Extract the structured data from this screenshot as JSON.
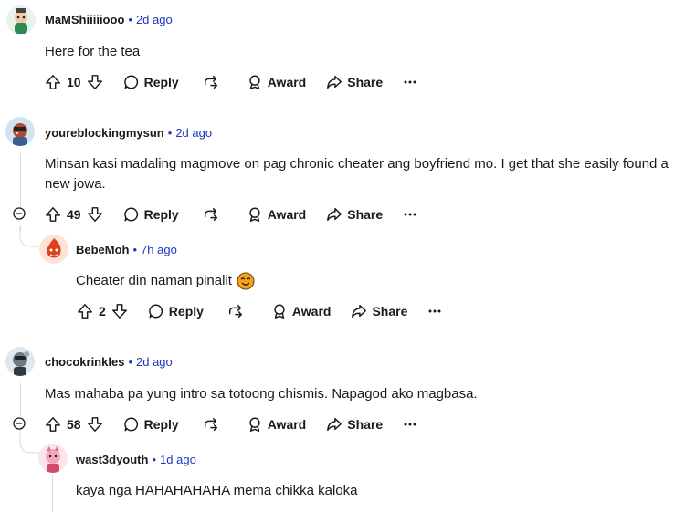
{
  "comments": [
    {
      "author": "MaMShiiiiiooo",
      "time": "2d ago",
      "body": "Here for the tea",
      "score": "10"
    },
    {
      "author": "youreblockingmysun",
      "time": "2d ago",
      "body": "Minsan kasi madaling magmove on pag chronic cheater ang boyfriend mo. I get that she easily found a new jowa.",
      "score": "49"
    },
    {
      "author": "BebeMoh",
      "time": "7h ago",
      "body": "Cheater din naman pinalit",
      "score": "2"
    },
    {
      "author": "chocokrinkles",
      "time": "2d ago",
      "body": "Mas mahaba pa yung intro sa totoong chismis. Napagod ako magbasa.",
      "score": "58"
    },
    {
      "author": "wast3dyouth",
      "time": "1d ago",
      "body": "kaya nga HAHAHAHAHA mema chikka kaloka"
    }
  ],
  "labels": {
    "separator": "•",
    "reply": "Reply",
    "award": "Award",
    "share": "Share"
  },
  "colors": {
    "link": "#1c39bb",
    "text": "#1a1a1b",
    "thread": "#d7dadc"
  },
  "icons": [
    "upvote-icon",
    "downvote-icon",
    "comment-icon",
    "crosspost-icon",
    "award-icon",
    "share-icon",
    "more-icon",
    "collapse-icon",
    "emoji-icon"
  ]
}
